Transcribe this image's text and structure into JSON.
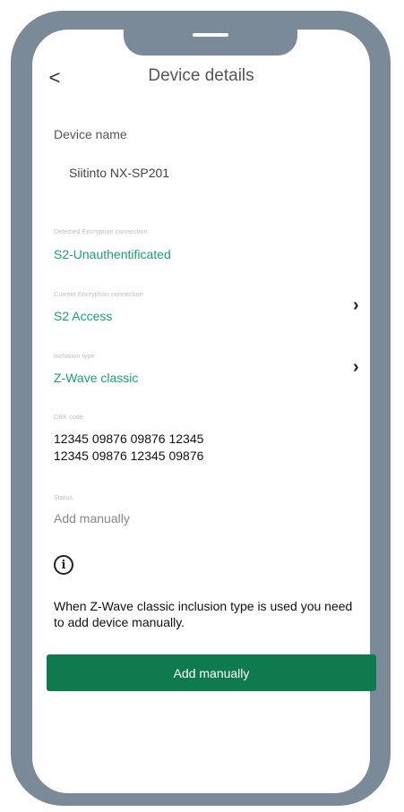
{
  "header": {
    "back_glyph": "<",
    "title": "Device details"
  },
  "device_name": {
    "label": "Device name",
    "value": "Siitinto NX-SP201"
  },
  "fields": {
    "detected_security": {
      "label": "Detected Encryption connection",
      "value": "S2-Unauthentificated"
    },
    "security_level": {
      "label": "Current Encryption connection",
      "value": "S2 Access"
    },
    "inclusion_type": {
      "label": "Inclusion type",
      "value": "Z-Wave classic"
    },
    "dsk_code": {
      "label": "DSK code",
      "line1": "12345 09876 09876 12345",
      "line2": "12345 09876 12345 09876"
    },
    "status": {
      "label": "Status",
      "value": "Add manually"
    }
  },
  "info": {
    "icon": "info-icon",
    "text": "When Z-Wave classic inclusion type is used you need to add device manually."
  },
  "actions": {
    "add_manually_label": "Add manually"
  },
  "colors": {
    "frame": "#7b8a99",
    "accent_green": "#17a17a",
    "button_green": "#0f7a4e"
  }
}
